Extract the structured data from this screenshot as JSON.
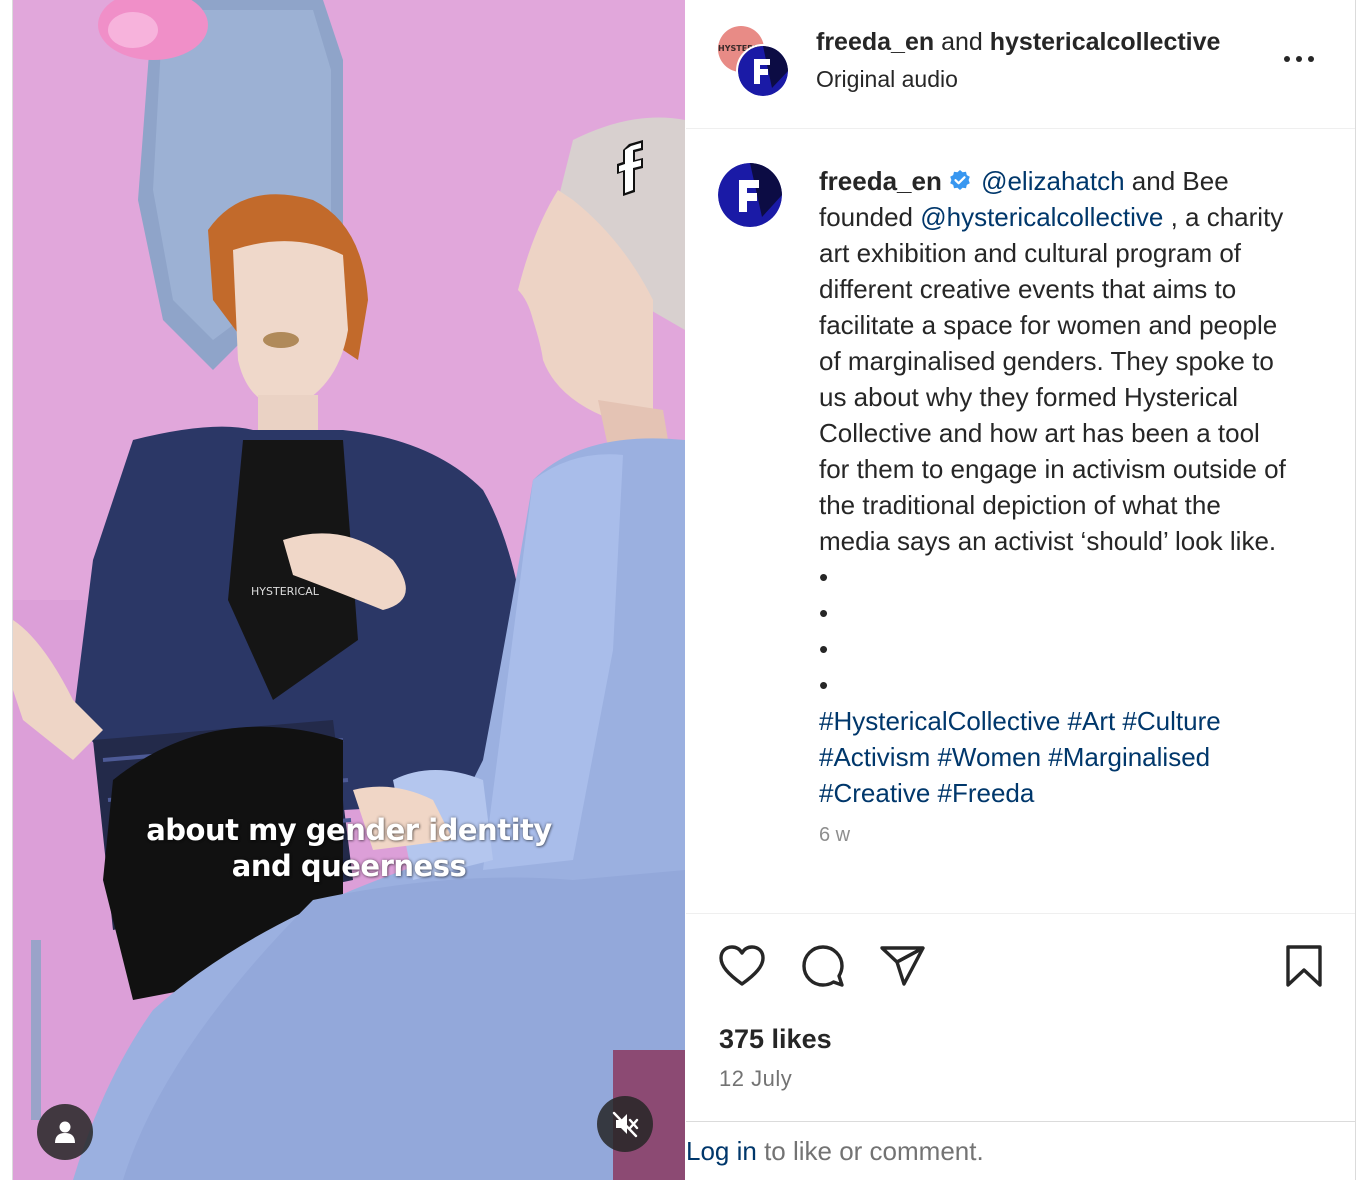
{
  "video": {
    "caption_line1": "about my gender identity",
    "caption_line2": "and queerness",
    "watermark": "f",
    "shirt_print": "HYSTERICAL"
  },
  "header": {
    "user1": "freeda_en",
    "conjunction": "and",
    "user2": "hystericalcollective",
    "subtitle": "Original audio",
    "back_avatar_text": "HYSTERICAL"
  },
  "post": {
    "username": "freeda_en",
    "mention1": "@elizahatch",
    "text1": "and Bee founded",
    "mention2": "@hystericalcollective",
    "text2": ", a charity art exhibition and cultural program of different creative events that aims to facilitate a space for women and people of marginalised genders. They spoke to us about why they formed Hysterical Collective and how art has been a tool for them to engage in activism outside of the traditional depiction of what the media says an activist ‘should’ look like.",
    "dots": [
      "•",
      "•",
      "•",
      "•"
    ],
    "hashtags": "#HystericalCollective #Art #Culture #Activism #Women #Marginalised #Creative #Freeda",
    "age": "6 w"
  },
  "stats": {
    "likes": "375 likes",
    "date": "12 July"
  },
  "footer": {
    "login_link": "Log in",
    "login_rest": " to like or comment."
  },
  "colors": {
    "link": "#00376b",
    "verified": "#3897f0",
    "brand_blue": "#1a1aa6"
  },
  "icons": [
    "heart-icon",
    "comment-icon",
    "share-icon",
    "bookmark-icon",
    "more-icon",
    "user-icon",
    "muted-icon",
    "verified-icon"
  ]
}
